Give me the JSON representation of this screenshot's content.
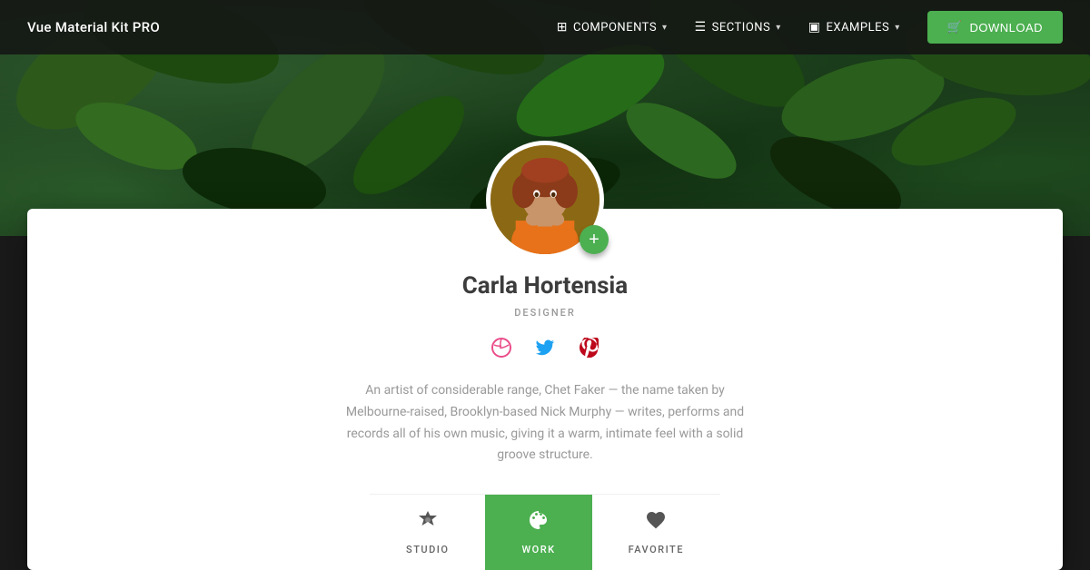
{
  "navbar": {
    "brand": "Vue Material Kit PRO",
    "items": [
      {
        "id": "components",
        "label": "COMPONENTS",
        "icon": "⊞",
        "has_chevron": true
      },
      {
        "id": "sections",
        "label": "SECTIONS",
        "icon": "☰",
        "has_chevron": true
      },
      {
        "id": "examples",
        "label": "EXAMPLES",
        "icon": "▣",
        "has_chevron": true
      }
    ],
    "download_label": "DOWNLOAD"
  },
  "profile": {
    "name": "Carla Hortensia",
    "title": "DESIGNER",
    "bio": "An artist of considerable range, Chet Faker — the name taken by Melbourne-raised, Brooklyn-based Nick Murphy — writes, performs and records all of his own music, giving it a warm, intimate feel with a solid groove structure.",
    "avatar_plus": "+"
  },
  "social": {
    "dribbble_icon": "◎",
    "twitter_icon": "🐦",
    "pinterest_icon": "📌"
  },
  "tabs": [
    {
      "id": "studio",
      "label": "STUDIO",
      "icon": "◉",
      "active": false
    },
    {
      "id": "work",
      "label": "WORK",
      "icon": "🎨",
      "active": true
    },
    {
      "id": "favorite",
      "label": "FAVORITE",
      "icon": "♥",
      "active": false
    }
  ],
  "colors": {
    "green": "#4caf50",
    "dark_bg": "#1c3a1c"
  }
}
